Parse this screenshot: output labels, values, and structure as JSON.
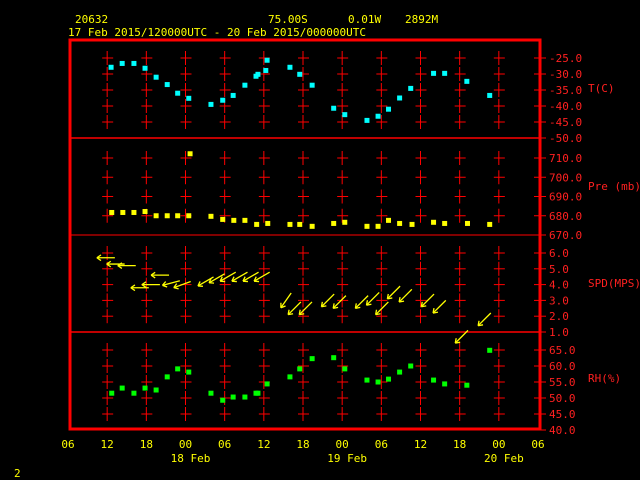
{
  "header": {
    "station": "20632",
    "lat": "75.00S",
    "lon": "0.01W",
    "elev": "2892M",
    "time_range": "17 Feb 2015/120000UTC - 20 Feb 2015/000000UTC"
  },
  "page_number": "2",
  "colors": {
    "frame": "#ff0000",
    "text": "#ffff00",
    "temp": "#00ffff",
    "pressure": "#ffff00",
    "wind": "#ffff00",
    "rh": "#00ff00"
  },
  "chart_data": {
    "type": "scatter",
    "x_unit": "hours since 17 Feb 2015 06UTC",
    "xlim": [
      0,
      72
    ],
    "x_tick_labels": [
      "06",
      "12",
      "18",
      "00",
      "06",
      "12",
      "18",
      "00",
      "06",
      "12",
      "18",
      "00",
      "06"
    ],
    "day_labels": [
      {
        "label": "18 Feb",
        "hour": 18
      },
      {
        "label": "19 Feb",
        "hour": 42
      },
      {
        "label": "20 Feb",
        "hour": 66
      }
    ],
    "panels": [
      {
        "name": "temperature",
        "ylabel": "T(C)",
        "ylim": [
          -50,
          -25
        ],
        "tick_labels": [
          "-25.0",
          "-30.0",
          "-35.0",
          "-40.0",
          "-45.0",
          "-50.0"
        ],
        "x": [
          6.6,
          8.3,
          10.1,
          11.8,
          13.5,
          15.2,
          16.8,
          18.5,
          21.9,
          23.7,
          25.3,
          27.1,
          28.8,
          29.1,
          30.3,
          30.5,
          34.0,
          35.5,
          37.4,
          40.7,
          42.4,
          45.8,
          47.5,
          49.1,
          50.8,
          52.5,
          56.0,
          57.7,
          61.1,
          64.6
        ],
        "y": [
          -27.9,
          -26.7,
          -26.7,
          -28.2,
          -31.0,
          -33.3,
          -36.0,
          -37.6,
          -39.5,
          -38.2,
          -36.7,
          -33.5,
          -30.7,
          -30.1,
          -28.9,
          -25.7,
          -27.9,
          -30.1,
          -33.5,
          -40.7,
          -42.7,
          -44.5,
          -43.2,
          -41.0,
          -37.5,
          -34.5,
          -29.8,
          -29.8,
          -32.3,
          -36.7
        ]
      },
      {
        "name": "pressure",
        "ylabel": "Pre (mb)",
        "ylim": [
          670,
          710
        ],
        "tick_labels": [
          "710.0",
          "700.0",
          "690.0",
          "680.0",
          "670.0"
        ],
        "x": [
          6.7,
          8.4,
          10.1,
          11.8,
          13.5,
          15.2,
          16.8,
          18.5,
          18.7,
          21.9,
          23.7,
          25.4,
          27.1,
          28.9,
          30.6,
          34.0,
          35.5,
          37.4,
          40.7,
          42.4,
          45.8,
          47.5,
          49.1,
          50.8,
          52.7,
          56.0,
          57.7,
          61.2,
          64.6
        ],
        "y": [
          681.7,
          681.7,
          681.7,
          682.2,
          680.0,
          680.0,
          680.0,
          680.0,
          712.2,
          679.7,
          678.1,
          677.6,
          677.6,
          675.5,
          676.0,
          675.5,
          675.5,
          674.5,
          676.0,
          676.6,
          674.5,
          674.5,
          677.6,
          676.0,
          675.5,
          676.6,
          676.0,
          676.0,
          675.5
        ]
      },
      {
        "name": "wind",
        "ylabel": "SPD(MPS)",
        "ylim": [
          1,
          6
        ],
        "tick_labels": [
          "6.0",
          "5.0",
          "4.0",
          "3.0",
          "2.0",
          "1.0"
        ],
        "x": [
          5.8,
          7.3,
          9.0,
          11.0,
          12.7,
          14.1,
          15.8,
          17.5,
          21.1,
          22.8,
          24.5,
          26.3,
          28.0,
          29.7,
          33.4,
          34.7,
          36.4,
          39.8,
          41.6,
          45.0,
          46.7,
          48.1,
          49.9,
          51.7,
          55.1,
          56.9,
          60.3,
          63.8
        ],
        "y": [
          5.7,
          5.3,
          5.2,
          3.8,
          4.0,
          4.6,
          4.1,
          4.0,
          4.2,
          4.4,
          4.5,
          4.5,
          4.5,
          4.5,
          3.0,
          2.5,
          2.5,
          3.0,
          2.9,
          2.9,
          3.1,
          2.5,
          3.5,
          3.3,
          3.0,
          2.6,
          0.7,
          1.8
        ],
        "direction_deg": [
          90,
          90,
          90,
          90,
          90,
          90,
          75,
          70,
          60,
          60,
          60,
          60,
          60,
          60,
          35,
          45,
          45,
          45,
          45,
          45,
          45,
          45,
          45,
          45,
          45,
          45,
          45,
          45
        ]
      },
      {
        "name": "rh",
        "ylabel": "RH(%)",
        "ylim": [
          40,
          65
        ],
        "tick_labels": [
          "65.0",
          "60.0",
          "55.0",
          "50.0",
          "45.0",
          "40.0"
        ],
        "x": [
          6.7,
          8.3,
          10.1,
          11.8,
          13.5,
          15.2,
          16.8,
          18.5,
          21.9,
          23.7,
          25.3,
          27.1,
          28.8,
          29.1,
          30.5,
          34.0,
          35.5,
          37.4,
          40.7,
          42.4,
          45.8,
          47.5,
          49.1,
          50.8,
          52.5,
          56.0,
          57.7,
          61.1,
          64.6
        ],
        "y": [
          51.5,
          53.1,
          51.5,
          53.1,
          52.5,
          56.6,
          59.1,
          58.1,
          51.5,
          49.3,
          50.3,
          50.3,
          51.5,
          51.5,
          54.4,
          56.6,
          59.1,
          62.3,
          62.6,
          59.1,
          55.6,
          55.0,
          55.9,
          58.1,
          60.0,
          55.6,
          54.4,
          54.0,
          64.9
        ]
      }
    ]
  }
}
